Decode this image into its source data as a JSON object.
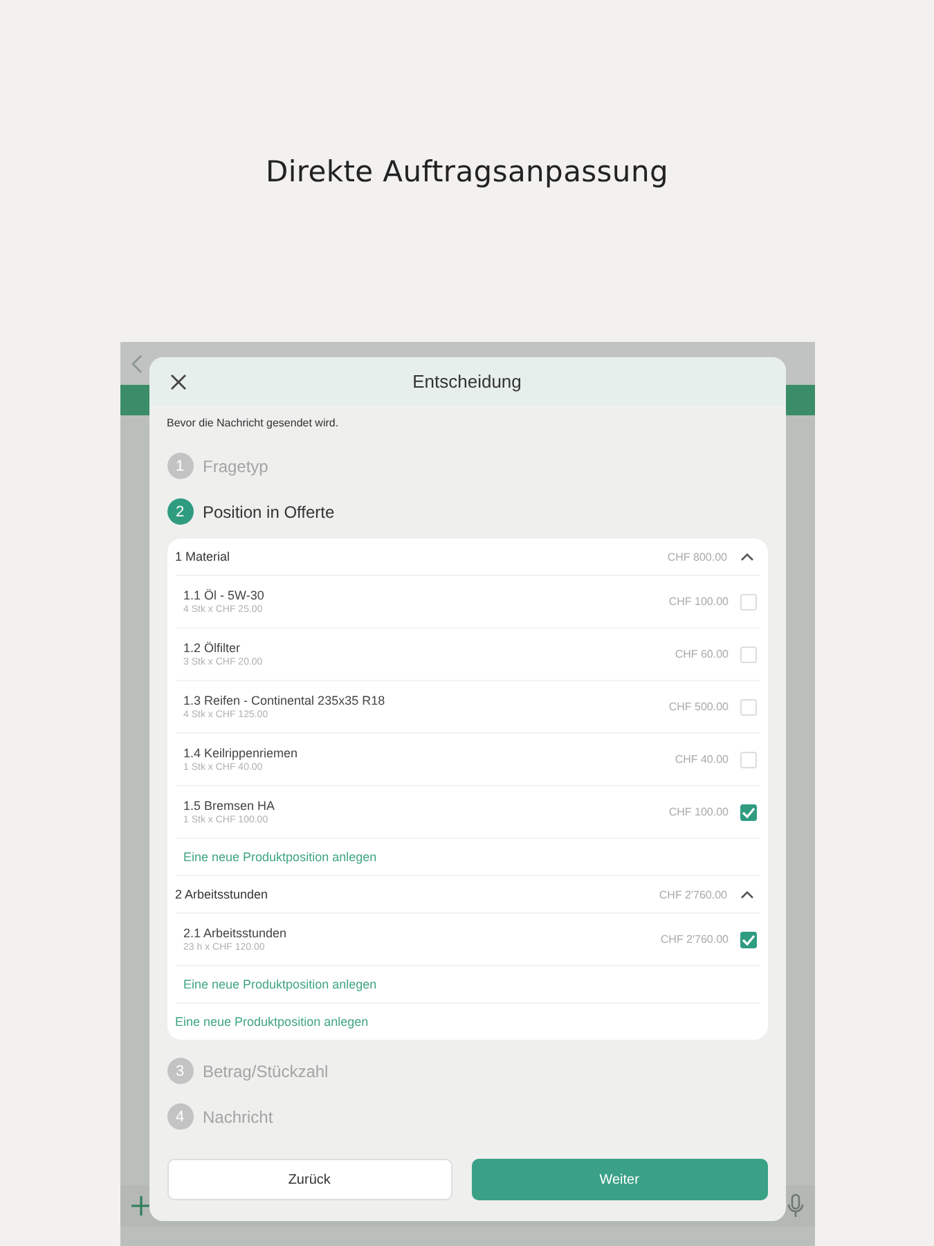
{
  "headline": "Direkte Auftragsanpassung",
  "dialog": {
    "title": "Entscheidung",
    "subtitle": "Bevor die Nachricht gesendet wird.",
    "steps_before": [
      {
        "number": "1",
        "label": "Fragetyp",
        "selected": false
      },
      {
        "number": "2",
        "label": "Position in Offerte",
        "selected": true
      }
    ],
    "groups": [
      {
        "title": "1 Material",
        "total": "CHF 800.00",
        "expanded": true,
        "items": [
          {
            "name": "1.1 Öl - 5W-30",
            "detail": "4 Stk x CHF 25.00",
            "price": "CHF 100.00",
            "checked": false
          },
          {
            "name": "1.2 Ölfilter",
            "detail": "3 Stk x CHF 20.00",
            "price": "CHF 60.00",
            "checked": false
          },
          {
            "name": "1.3 Reifen - Continental 235x35 R18",
            "detail": "4 Stk x CHF 125.00",
            "price": "CHF 500.00",
            "checked": false
          },
          {
            "name": "1.4 Keilrippenriemen",
            "detail": "1 Stk x CHF 40.00",
            "price": "CHF 40.00",
            "checked": false
          },
          {
            "name": "1.5 Bremsen HA",
            "detail": "1 Stk x CHF 100.00",
            "price": "CHF 100.00",
            "checked": true
          }
        ],
        "add_link": "Eine neue Produktposition anlegen"
      },
      {
        "title": "2 Arbeitsstunden",
        "total": "CHF 2'760.00",
        "expanded": true,
        "items": [
          {
            "name": "2.1 Arbeitsstunden",
            "detail": "23 h x CHF 120.00",
            "price": "CHF 2'760.00",
            "checked": true
          }
        ],
        "add_link": "Eine neue Produktposition anlegen"
      }
    ],
    "add_link": "Eine neue Produktposition anlegen",
    "steps_after": [
      {
        "number": "3",
        "label": "Betrag/Stückzahl",
        "selected": false
      },
      {
        "number": "4",
        "label": "Nachricht",
        "selected": false
      }
    ],
    "buttons": {
      "back": "Zurück",
      "next": "Weiter"
    }
  }
}
